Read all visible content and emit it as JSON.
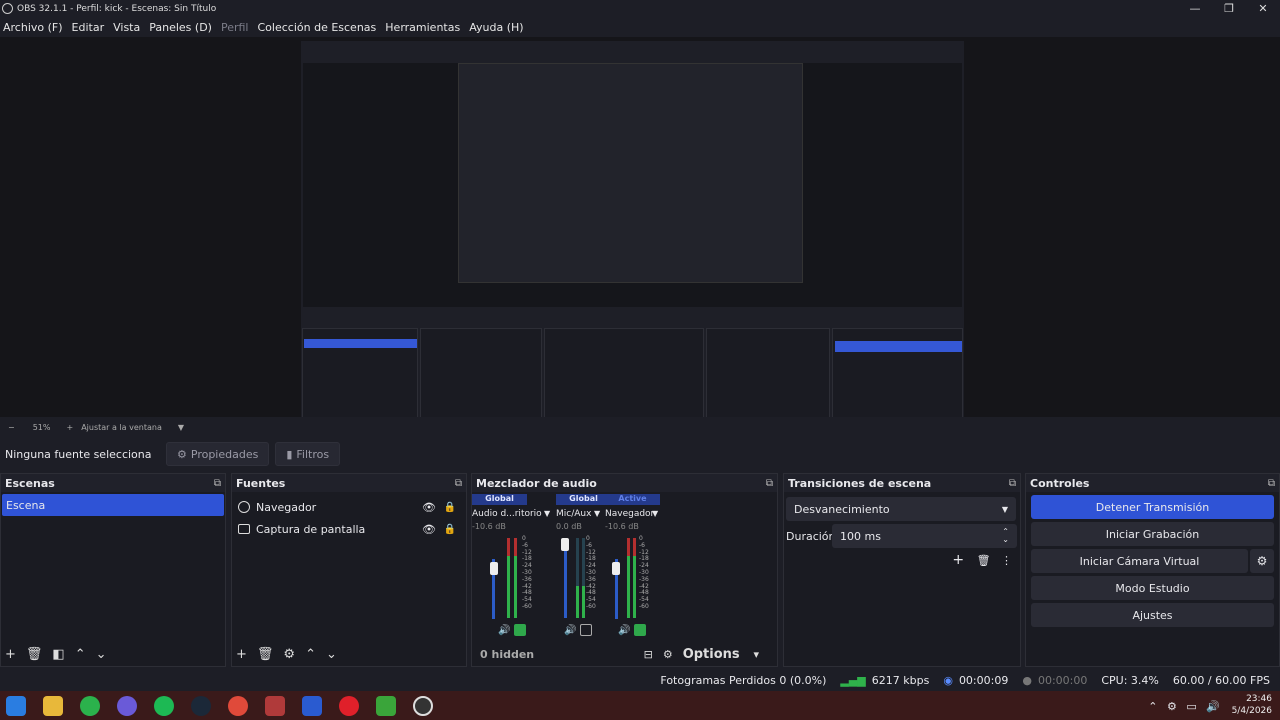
{
  "window": {
    "title": "OBS 32.1.1 - Perfil: kick - Escenas: Sin Título",
    "controls": [
      "—",
      "❐",
      "✕"
    ]
  },
  "menu": [
    {
      "label": "Archivo (F)",
      "enabled": true
    },
    {
      "label": "Editar",
      "enabled": true
    },
    {
      "label": "Vista",
      "enabled": true
    },
    {
      "label": "Paneles (D)",
      "enabled": true
    },
    {
      "label": "Perfil",
      "enabled": false
    },
    {
      "label": "Colección de Escenas",
      "enabled": true
    },
    {
      "label": "Herramientas",
      "enabled": true
    },
    {
      "label": "Ayuda (H)",
      "enabled": true
    }
  ],
  "zoom": {
    "minus": "−",
    "value": "51%",
    "plus": "+",
    "fit": "Ajustar a la ventana",
    "arrow": "▼"
  },
  "sourcebar": {
    "selection": "Ninguna fuente selecciona",
    "properties": "Propiedades",
    "filters": "Filtros"
  },
  "scenes": {
    "title": "Escenas",
    "items": [
      "Escena"
    ]
  },
  "sources": {
    "title": "Fuentes",
    "items": [
      "Navegador",
      "Captura de pantalla"
    ]
  },
  "mixer": {
    "title": "Mezclador de audio",
    "strips": [
      {
        "badge": "Global",
        "name": "Audio d...ritorio",
        "db": "-10.6 dB"
      },
      {
        "badge": "Global",
        "name": "Mic/Aux",
        "db": "0.0 dB"
      },
      {
        "badge": "Active",
        "name": "Navegador",
        "db": "-10.6 dB"
      }
    ],
    "scale": [
      "0",
      "-6",
      "-12",
      "-18",
      "-24",
      "-30",
      "-36",
      "-42",
      "-48",
      "-54",
      "-60"
    ],
    "hidden": "0 hidden",
    "options": "Options"
  },
  "transitions": {
    "title": "Transiciones de escena",
    "type": "Desvanecimiento",
    "duration_label": "Duración",
    "duration": "100 ms"
  },
  "controls": {
    "title": "Controles",
    "stream": "Detener Transmisión",
    "record": "Iniciar Grabación",
    "vcam": "Iniciar Cámara Virtual",
    "studio": "Modo Estudio",
    "settings": "Ajustes"
  },
  "status": {
    "dropped": "Fotogramas Perdidos 0 (0.0%)",
    "bitrate": "6217 kbps",
    "stream_time": "00:00:09",
    "rec_time": "00:00:00",
    "cpu": "CPU: 3.4%",
    "fps": "60.00 / 60.00 FPS"
  },
  "clock": {
    "time": "23:46",
    "date": "5/4/2026"
  },
  "colors": {
    "accent": "#2f53d6",
    "meter_blue": "#2c5cc7",
    "meter_green": "#2fb24b",
    "meter_red": "#b32f2f"
  },
  "taskbar_icons": [
    "windows-start-icon",
    "file-explorer-icon",
    "whatsapp-icon",
    "discord-icon",
    "spotify-icon",
    "steam-icon",
    "chrome-icon",
    "game-icon",
    "xbox-icon",
    "opera-icon",
    "minecraft-icon",
    "obs-icon"
  ]
}
